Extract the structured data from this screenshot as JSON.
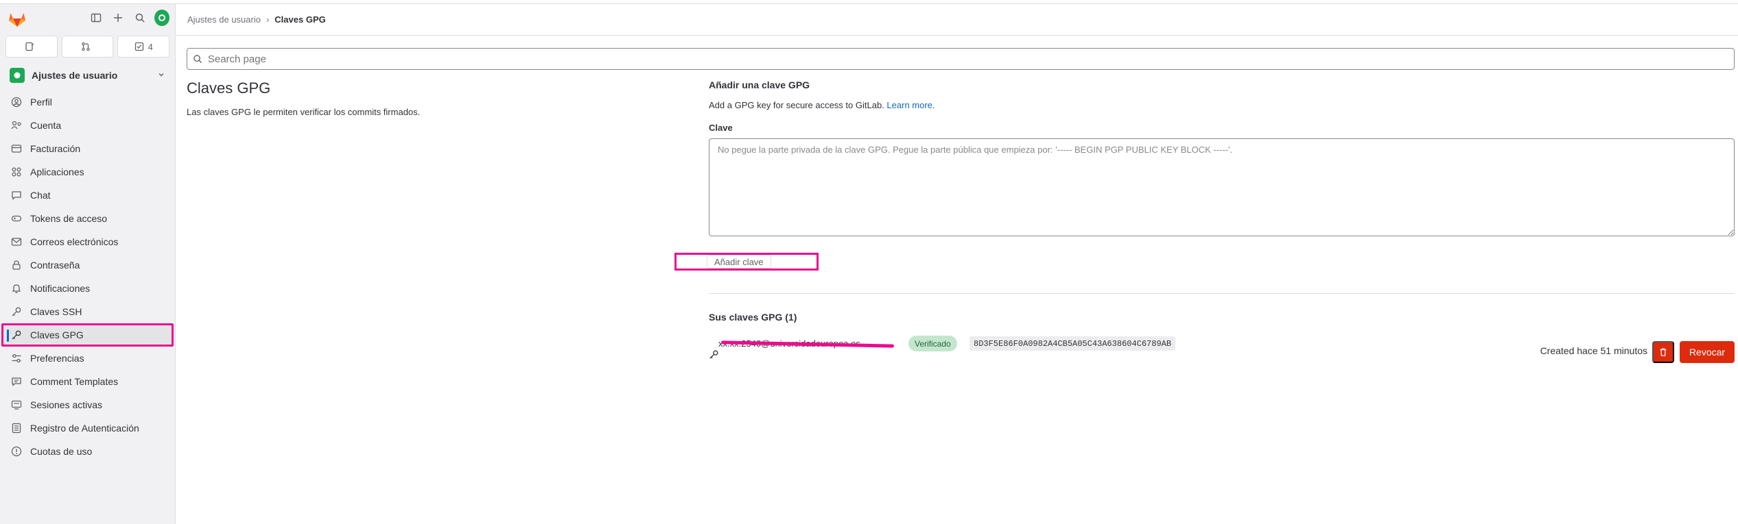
{
  "sidebar": {
    "counts": {
      "issues": "",
      "merge_requests": "",
      "todos": "4"
    },
    "context_title": "Ajustes de usuario",
    "items": [
      {
        "label": "Perfil",
        "icon": "user-icon"
      },
      {
        "label": "Cuenta",
        "icon": "account-icon"
      },
      {
        "label": "Facturación",
        "icon": "credit-card-icon"
      },
      {
        "label": "Aplicaciones",
        "icon": "apps-icon"
      },
      {
        "label": "Chat",
        "icon": "comment-icon"
      },
      {
        "label": "Tokens de acceso",
        "icon": "token-icon"
      },
      {
        "label": "Correos electrónicos",
        "icon": "mail-icon"
      },
      {
        "label": "Contraseña",
        "icon": "lock-icon"
      },
      {
        "label": "Notificaciones",
        "icon": "bell-icon"
      },
      {
        "label": "Claves SSH",
        "icon": "key-icon"
      },
      {
        "label": "Claves GPG",
        "icon": "key-icon"
      },
      {
        "label": "Preferencias",
        "icon": "preferences-icon"
      },
      {
        "label": "Comment Templates",
        "icon": "comment-template-icon"
      },
      {
        "label": "Sesiones activas",
        "icon": "monitor-icon"
      },
      {
        "label": "Registro de Autenticación",
        "icon": "log-icon"
      },
      {
        "label": "Cuotas de uso",
        "icon": "quota-icon"
      }
    ]
  },
  "breadcrumb": {
    "parent": "Ajustes de usuario",
    "current": "Claves GPG"
  },
  "search": {
    "placeholder": "Search page"
  },
  "section": {
    "title": "Claves GPG",
    "description": "Las claves GPG le permiten verificar los commits firmados."
  },
  "form": {
    "title": "Añadir una clave GPG",
    "description": "Add a GPG key for secure access to GitLab.",
    "learn_more": "Learn more.",
    "key_label": "Clave",
    "key_placeholder": "No pegue la parte privada de la clave GPG. Pegue la parte pública que empieza por: '----- BEGIN PGP PUBLIC KEY BLOCK -----'.",
    "add_button": "Añadir clave"
  },
  "keys": {
    "title": "Sus claves GPG (1)",
    "items": [
      {
        "email": "xx.xx.2540@universidadeuropea.es",
        "status": "Verificado",
        "fingerprint": "8D3F5E86F0A0982A4CB5A05C43A638604C6789AB",
        "created": "Created hace 51 minutos",
        "revoke": "Revocar"
      }
    ]
  },
  "colors": {
    "accent": "#ec0b8d",
    "danger": "#dd2b0e",
    "link": "#1068bf",
    "success_bg": "#c3e6cd"
  }
}
